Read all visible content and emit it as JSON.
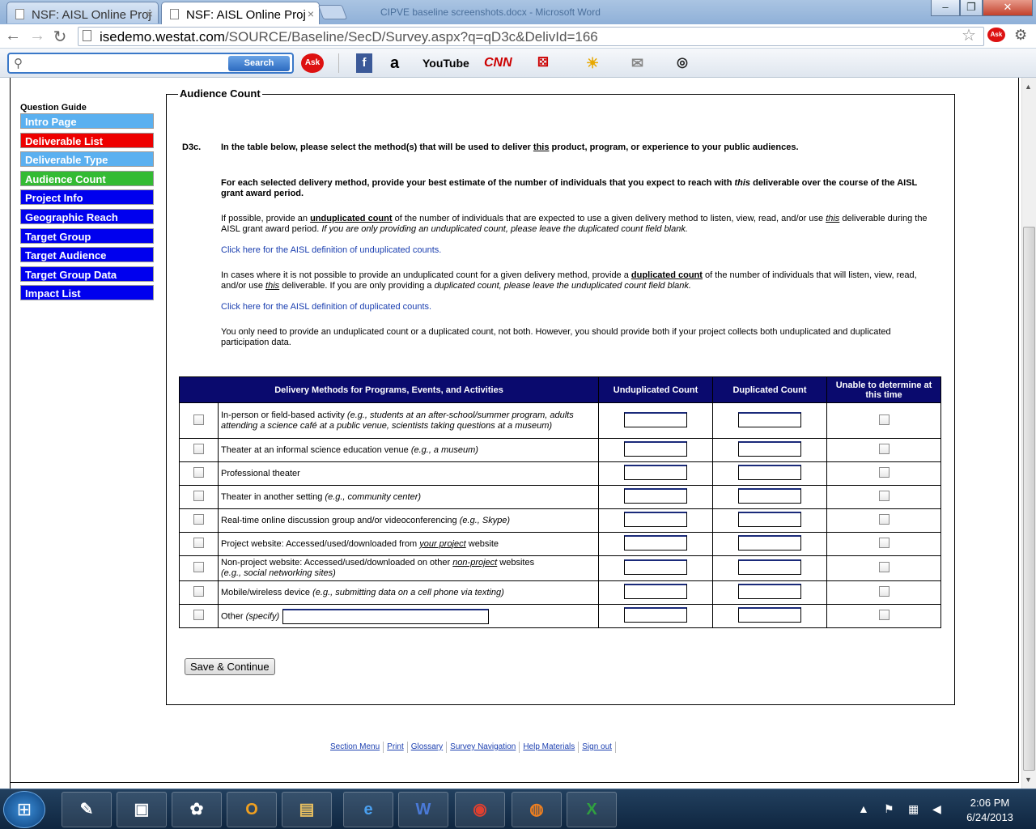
{
  "browser": {
    "tabs": [
      {
        "label": "NSF: AISL Online Proj",
        "active": false
      },
      {
        "label": "NSF: AISL Online Proj",
        "active": true
      }
    ],
    "window_title": "CIPVE baseline screenshots.docx - Microsoft Word",
    "url_host": "isedemo.westat.com",
    "url_path": "/SOURCE/Baseline/SecD/Survey.aspx?q=qD3c&DelivId=166",
    "toolbar": {
      "search_button": "Search",
      "search_placeholder": "",
      "ask_label": "Ask",
      "amazon_label": "a",
      "youtube_label": "YouTube",
      "cnn_label": "CNN"
    }
  },
  "question_guide": {
    "title": "Question Guide",
    "items": [
      {
        "label": "Intro Page",
        "color": "#5ab0f0"
      },
      {
        "label": "Deliverable List",
        "color": "#ee0000"
      },
      {
        "label": "Deliverable Type",
        "color": "#5ab0f0"
      },
      {
        "label": "Audience Count",
        "color": "#33bb33"
      },
      {
        "label": "Project Info",
        "color": "#0000ee"
      },
      {
        "label": "Geographic Reach",
        "color": "#0000ee"
      },
      {
        "label": "Target Group",
        "color": "#0000ee"
      },
      {
        "label": "Target Audience",
        "color": "#0000ee"
      },
      {
        "label": "Target Group Data",
        "color": "#0000ee"
      },
      {
        "label": "Impact List",
        "color": "#0000ee"
      }
    ]
  },
  "section": {
    "legend": "Audience Count",
    "question_number": "D3c.",
    "p1": {
      "a": "In the table below, please select the method(s) that will be used to deliver ",
      "em": "this",
      "b": " product, program, or experience to your public audiences."
    },
    "p2": {
      "a": "For each selected delivery method, provide your best estimate of the number of individuals that you expect to reach with ",
      "em": "this",
      "b": " deliverable over the course of the AISL grant award period."
    },
    "p3": {
      "a": "If possible, provide an ",
      "strong": "unduplicated count",
      "b": " of the number of individuals that are expected to use a given delivery method to listen, view, read, and/or use ",
      "em": "this",
      "c": " deliverable during the AISL grant award period. ",
      "italic": "If you are only providing an unduplicated count, please leave the duplicated count field blank."
    },
    "link1": "Click here for the AISL definition of unduplicated counts.",
    "p4": {
      "a": "In cases where it is not possible to provide an unduplicated count for a given delivery method, provide a ",
      "strong": "duplicated count",
      "b": " of the number of individuals that will listen, view, read, and/or use ",
      "em": "this",
      "c": " deliverable. If you are only providing a ",
      "italic": "duplicated count, please leave the unduplicated count field blank."
    },
    "link2": "Click here for the AISL definition of duplicated counts.",
    "p5": "You only need to provide an unduplicated count or a duplicated count, not both. However, you should provide both if your project collects both unduplicated and duplicated participation data."
  },
  "table": {
    "headers": {
      "method": "Delivery Methods for Programs, Events, and Activities",
      "unduplicated": "Unduplicated Count",
      "duplicated": "Duplicated Count",
      "unable": "Unable to determine at this time"
    },
    "rows": [
      {
        "text": "In-person or field-based activity ",
        "example": "(e.g., students at an after-school/summer program, adults attending a science café at a public venue, scientists taking questions at a museum)"
      },
      {
        "text": "Theater at an informal science education venue ",
        "example": "(e.g., a museum)"
      },
      {
        "text": "Professional theater",
        "example": ""
      },
      {
        "text": "Theater in another setting ",
        "example": "(e.g., community center)"
      },
      {
        "text": "Real-time online discussion group and/or videoconferencing ",
        "example": "(e.g., Skype)"
      },
      {
        "text": "Project website: Accessed/used/downloaded from ",
        "underline": "your project",
        "tail": " website",
        "example": ""
      },
      {
        "text": "Non-project website: Accessed/used/downloaded on other ",
        "underline": "non-project",
        "tail": " websites",
        "example": "(e.g., social networking sites)"
      },
      {
        "text": "Mobile/wireless device ",
        "example": "(e.g., submitting data on a cell phone via texting)"
      },
      {
        "text": "Other ",
        "example": "(specify)"
      }
    ]
  },
  "save_button": "Save & Continue",
  "footer_links": [
    "Section Menu",
    "Print",
    "Glossary",
    "Survey Navigation",
    "Help Materials",
    "Sign out"
  ],
  "taskbar": {
    "time": "2:06 PM",
    "date": "6/24/2013",
    "apps": [
      "notepad",
      "sticky-notes",
      "paint",
      "outlook",
      "explorer",
      "ie",
      "word",
      "chrome",
      "firefox",
      "excel"
    ]
  }
}
